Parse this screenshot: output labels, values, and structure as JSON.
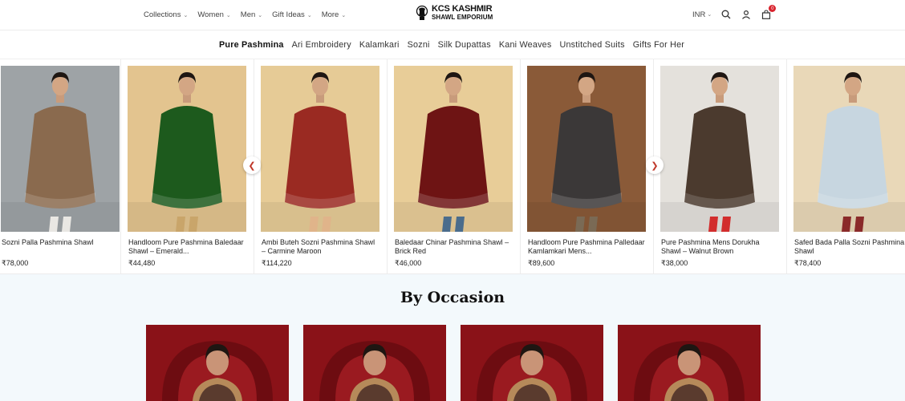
{
  "header": {
    "nav": [
      {
        "label": "Collections"
      },
      {
        "label": "Women"
      },
      {
        "label": "Men"
      },
      {
        "label": "Gift Ideas"
      },
      {
        "label": "More"
      }
    ],
    "logo_line1": "KCS KASHMIR",
    "logo_line2": "SHAWL EMPORIUM",
    "currency": "INR",
    "cart_count": "0"
  },
  "categories": [
    {
      "label": "Pure Pashmina",
      "active": true
    },
    {
      "label": "Ari Embroidery"
    },
    {
      "label": "Kalamkari"
    },
    {
      "label": "Sozni"
    },
    {
      "label": "Silk Dupattas"
    },
    {
      "label": "Kani Weaves"
    },
    {
      "label": "Unstitched Suits"
    },
    {
      "label": "Gifts For Her"
    }
  ],
  "products": [
    {
      "title": "Sozni Palla Pashmina Shawl",
      "price": "₹78,000",
      "colors": {
        "bg": "#9ea3a6",
        "shawl": "#8a6a4e",
        "accent": "#e9e7e3"
      }
    },
    {
      "title": "Handloom Pure Pashmina Baledaar Shawl – Emerald...",
      "price": "₹44,480",
      "colors": {
        "bg": "#e3c48f",
        "shawl": "#1d5a1d",
        "accent": "#c9a56a"
      }
    },
    {
      "title": "Ambi Buteh Sozni Pashmina Shawl – Carmine Maroon",
      "price": "₹114,220",
      "colors": {
        "bg": "#e6cb96",
        "shawl": "#9a2a22",
        "accent": "#e0b48a"
      }
    },
    {
      "title": "Baledaar Chinar Pashmina Shawl – Brick Red",
      "price": "₹46,000",
      "colors": {
        "bg": "#e8cd98",
        "shawl": "#6e1414",
        "accent": "#4a6c8c"
      }
    },
    {
      "title": "Handloom Pure Pashmina Palledaar Kamlamkari Mens...",
      "price": "₹89,600",
      "colors": {
        "bg": "#8a5a38",
        "shawl": "#3b3838",
        "accent": "#7a6a55"
      }
    },
    {
      "title": "Pure Pashmina Mens Dorukha Shawl – Walnut Brown",
      "price": "₹38,000",
      "colors": {
        "bg": "#e4e1dc",
        "shawl": "#4b3a2e",
        "accent": "#d22d2d"
      }
    },
    {
      "title": "Safed Bada Palla Sozni Pashmina Shawl",
      "price": "₹78,400",
      "colors": {
        "bg": "#e9d8b8",
        "shawl": "#c7d6e0",
        "accent": "#8a2a2a"
      }
    }
  ],
  "occasion": {
    "title": "By Occasion",
    "cards": [
      {
        "name": "occasion-card-1"
      },
      {
        "name": "occasion-card-2"
      },
      {
        "name": "occasion-card-3"
      },
      {
        "name": "occasion-card-4"
      }
    ]
  },
  "icons": [
    "search-icon",
    "user-icon",
    "bag-icon",
    "chevron-left-icon",
    "chevron-right-icon"
  ]
}
